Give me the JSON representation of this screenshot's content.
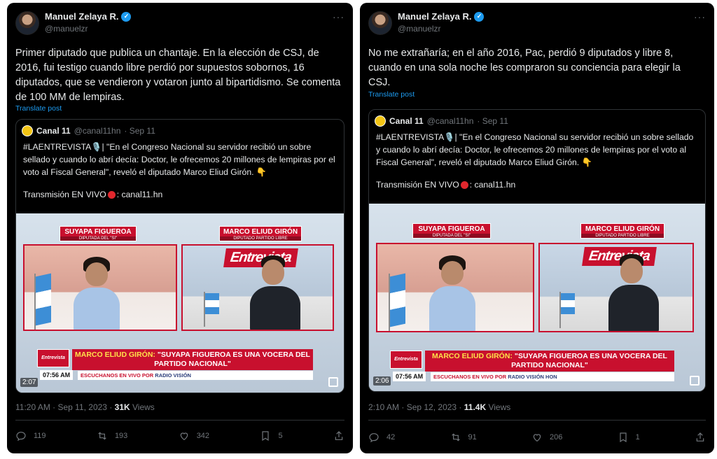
{
  "tweets": [
    {
      "author": {
        "name": "Manuel Zelaya R.",
        "handle": "@manuelzr",
        "verified_icon": "verified-badge-icon"
      },
      "text": "Primer diputado que publica un chantaje. En la elección de CSJ, de 2016, fui testigo cuando libre perdió por supuestos sobornos, 16 diputados, que se vendieron y votaron junto al bipartidismo. Se comenta de 100 MM de lempiras.",
      "translate_label": "Translate post",
      "quote": {
        "name": "Canal 11",
        "handle": "@canal11hn",
        "date": "· Sep 11",
        "text": "#LAENTREVISTA🎙️| \"En el Congreso Nacional su servidor recibió un sobre sellado y cuando lo abrí decía: Doctor, le ofrecemos 20 millones de lempiras por el voto al Fiscal General\", reveló el diputado Marco Eliud Girón. 👇",
        "live_prefix": "Transmisión EN VIVO",
        "live_suffix": ": canal11.hn",
        "video": {
          "guest1_name": "SUYAPA FIGUEROA",
          "guest1_role": "DIPUTADA DEL \"SI\"",
          "guest2_name": "MARCO ELIUD GIRÓN",
          "guest2_role": "DIPUTADO PARTIDO LIBRE",
          "show_logo": "Entrevista",
          "headline_name": "MARCO ELIUD GIRÓN:",
          "headline_rest": "\"SUYAPA FIGUEROA ES UNA VOCERA DEL PARTIDO NACIONAL\"",
          "clock": "07:56 AM",
          "ticker_prefix": "ESCUCHANOS EN VIVO POR",
          "ticker_station": "RADIO VISIÓN",
          "duration": "2:07"
        }
      },
      "time": "11:20 AM · Sep 11, 2023 ·",
      "views_count": "31K",
      "views_label": "Views",
      "stats": {
        "replies": "119",
        "reposts": "193",
        "likes": "342",
        "bookmarks": "5"
      }
    },
    {
      "author": {
        "name": "Manuel Zelaya R.",
        "handle": "@manuelzr",
        "verified_icon": "verified-badge-icon"
      },
      "text": "No me extrañaría; en el año 2016, Pac,  perdió 9 diputados y libre 8, cuando en una sola noche les compraron su conciencia para elegir la CSJ.",
      "translate_label": "Translate post",
      "quote": {
        "name": "Canal 11",
        "handle": "@canal11hn",
        "date": "· Sep 11",
        "text": "#LAENTREVISTA🎙️| \"En el Congreso Nacional su servidor recibió un sobre sellado y cuando lo abrí decía: Doctor, le ofrecemos 20 millones de lempiras por el voto al Fiscal General\", reveló el diputado Marco Eliud Girón. 👇",
        "live_prefix": "Transmisión EN VIVO",
        "live_suffix": ": canal11.hn",
        "video": {
          "guest1_name": "SUYAPA FIGUEROA",
          "guest1_role": "DIPUTADA DEL \"SI\"",
          "guest2_name": "MARCO ELIUD GIRÓN",
          "guest2_role": "DIPUTADO PARTIDO LIBRE",
          "show_logo": "Entrevista",
          "headline_name": "MARCO ELIUD GIRÓN:",
          "headline_rest": "\"SUYAPA FIGUEROA ES UNA VOCERA DEL PARTIDO NACIONAL\"",
          "clock": "07:56 AM",
          "ticker_prefix": "ESCUCHANOS EN VIVO POR",
          "ticker_station": "RADIO VISIÓN HON",
          "duration": "2:06"
        }
      },
      "time": "2:10 AM · Sep 12, 2023 ·",
      "views_count": "11.4K",
      "views_label": "Views",
      "stats": {
        "replies": "42",
        "reposts": "91",
        "likes": "206",
        "bookmarks": "1"
      }
    }
  ],
  "colors": {
    "background": "#000000",
    "link": "#1d9bf0",
    "muted": "#71767b",
    "brand_red": "#c8102e"
  }
}
